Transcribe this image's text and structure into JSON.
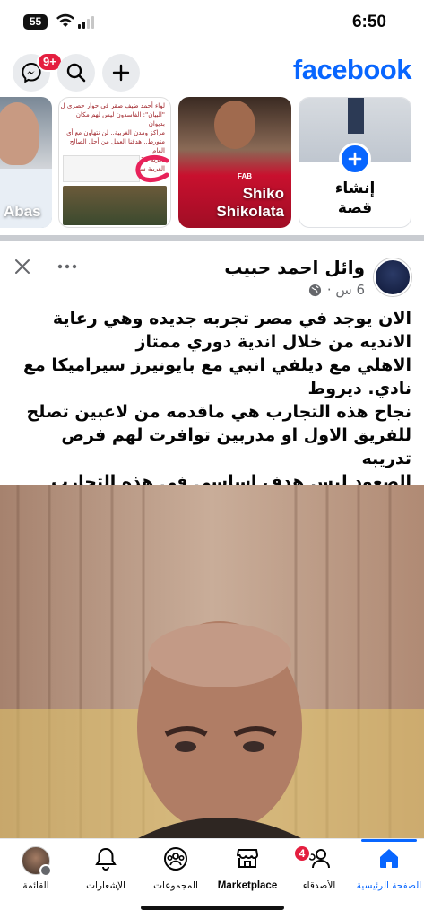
{
  "status_bar": {
    "time": "6:50",
    "battery": "55"
  },
  "header": {
    "logo": "facebook",
    "messenger_badge": "9+"
  },
  "stories": [
    {
      "name": "",
      "type": "create",
      "label": "إنشاء قصة"
    },
    {
      "name": "Shiko Shikolata"
    },
    {
      "name": "",
      "type": "news"
    },
    {
      "name": "Abas"
    }
  ],
  "news_story": {
    "lines": [
      "لواء أحمد ضيف صقر في حوار حصري ل",
      "\"البيان\": الفاسدون ليس لهم مكان بديوان",
      "مراكز ومدن الغربية.. لن نتهاون مع أي",
      "متورط.. هدفنا العمل من أجل الصالح العام",
      "تجربة 10 مدارس يابانية على أرض",
      "الغربية ستكون رائدة"
    ]
  },
  "post": {
    "author": "وائل احمد حبيب",
    "time": "6 س ·",
    "text": "الان يوجد في مصر  تجربه جديده وهي رعاية الانديه من خلال اندية دوري ممتاز\nالاهلي مع ديلفي انبي مع بايونيرز سيراميكا مع نادي. ديروط\nنجاح  هذه التجارب  هي   ماقدمه من لاعبين تصلح للفريق الاول او مدربين توافرت لهم فرص تدريبه\nالصعود ليس هدف اساسي في هذه التجارب\nولكن..........،،،،،،..........،،"
  },
  "nav": {
    "items": [
      {
        "label": "الصفحة الرئيسية",
        "active": true
      },
      {
        "label": "الأصدقاء",
        "badge": "4"
      },
      {
        "label": "Marketplace"
      },
      {
        "label": "المجموعات"
      },
      {
        "label": "الإشعارات"
      },
      {
        "label": "القائمة"
      }
    ]
  },
  "colors": {
    "brand": "#0866ff",
    "badge": "#e41e3f",
    "story_red": "#c8102e"
  }
}
